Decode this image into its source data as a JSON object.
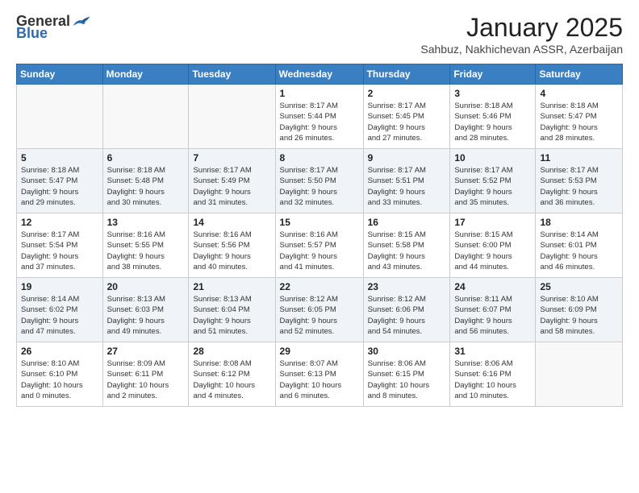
{
  "header": {
    "logo_general": "General",
    "logo_blue": "Blue",
    "month_title": "January 2025",
    "subtitle": "Sahbuz, Nakhichevan ASSR, Azerbaijan"
  },
  "weekdays": [
    "Sunday",
    "Monday",
    "Tuesday",
    "Wednesday",
    "Thursday",
    "Friday",
    "Saturday"
  ],
  "weeks": [
    [
      {
        "day": "",
        "info": ""
      },
      {
        "day": "",
        "info": ""
      },
      {
        "day": "",
        "info": ""
      },
      {
        "day": "1",
        "info": "Sunrise: 8:17 AM\nSunset: 5:44 PM\nDaylight: 9 hours\nand 26 minutes."
      },
      {
        "day": "2",
        "info": "Sunrise: 8:17 AM\nSunset: 5:45 PM\nDaylight: 9 hours\nand 27 minutes."
      },
      {
        "day": "3",
        "info": "Sunrise: 8:18 AM\nSunset: 5:46 PM\nDaylight: 9 hours\nand 28 minutes."
      },
      {
        "day": "4",
        "info": "Sunrise: 8:18 AM\nSunset: 5:47 PM\nDaylight: 9 hours\nand 28 minutes."
      }
    ],
    [
      {
        "day": "5",
        "info": "Sunrise: 8:18 AM\nSunset: 5:47 PM\nDaylight: 9 hours\nand 29 minutes."
      },
      {
        "day": "6",
        "info": "Sunrise: 8:18 AM\nSunset: 5:48 PM\nDaylight: 9 hours\nand 30 minutes."
      },
      {
        "day": "7",
        "info": "Sunrise: 8:17 AM\nSunset: 5:49 PM\nDaylight: 9 hours\nand 31 minutes."
      },
      {
        "day": "8",
        "info": "Sunrise: 8:17 AM\nSunset: 5:50 PM\nDaylight: 9 hours\nand 32 minutes."
      },
      {
        "day": "9",
        "info": "Sunrise: 8:17 AM\nSunset: 5:51 PM\nDaylight: 9 hours\nand 33 minutes."
      },
      {
        "day": "10",
        "info": "Sunrise: 8:17 AM\nSunset: 5:52 PM\nDaylight: 9 hours\nand 35 minutes."
      },
      {
        "day": "11",
        "info": "Sunrise: 8:17 AM\nSunset: 5:53 PM\nDaylight: 9 hours\nand 36 minutes."
      }
    ],
    [
      {
        "day": "12",
        "info": "Sunrise: 8:17 AM\nSunset: 5:54 PM\nDaylight: 9 hours\nand 37 minutes."
      },
      {
        "day": "13",
        "info": "Sunrise: 8:16 AM\nSunset: 5:55 PM\nDaylight: 9 hours\nand 38 minutes."
      },
      {
        "day": "14",
        "info": "Sunrise: 8:16 AM\nSunset: 5:56 PM\nDaylight: 9 hours\nand 40 minutes."
      },
      {
        "day": "15",
        "info": "Sunrise: 8:16 AM\nSunset: 5:57 PM\nDaylight: 9 hours\nand 41 minutes."
      },
      {
        "day": "16",
        "info": "Sunrise: 8:15 AM\nSunset: 5:58 PM\nDaylight: 9 hours\nand 43 minutes."
      },
      {
        "day": "17",
        "info": "Sunrise: 8:15 AM\nSunset: 6:00 PM\nDaylight: 9 hours\nand 44 minutes."
      },
      {
        "day": "18",
        "info": "Sunrise: 8:14 AM\nSunset: 6:01 PM\nDaylight: 9 hours\nand 46 minutes."
      }
    ],
    [
      {
        "day": "19",
        "info": "Sunrise: 8:14 AM\nSunset: 6:02 PM\nDaylight: 9 hours\nand 47 minutes."
      },
      {
        "day": "20",
        "info": "Sunrise: 8:13 AM\nSunset: 6:03 PM\nDaylight: 9 hours\nand 49 minutes."
      },
      {
        "day": "21",
        "info": "Sunrise: 8:13 AM\nSunset: 6:04 PM\nDaylight: 9 hours\nand 51 minutes."
      },
      {
        "day": "22",
        "info": "Sunrise: 8:12 AM\nSunset: 6:05 PM\nDaylight: 9 hours\nand 52 minutes."
      },
      {
        "day": "23",
        "info": "Sunrise: 8:12 AM\nSunset: 6:06 PM\nDaylight: 9 hours\nand 54 minutes."
      },
      {
        "day": "24",
        "info": "Sunrise: 8:11 AM\nSunset: 6:07 PM\nDaylight: 9 hours\nand 56 minutes."
      },
      {
        "day": "25",
        "info": "Sunrise: 8:10 AM\nSunset: 6:09 PM\nDaylight: 9 hours\nand 58 minutes."
      }
    ],
    [
      {
        "day": "26",
        "info": "Sunrise: 8:10 AM\nSunset: 6:10 PM\nDaylight: 10 hours\nand 0 minutes."
      },
      {
        "day": "27",
        "info": "Sunrise: 8:09 AM\nSunset: 6:11 PM\nDaylight: 10 hours\nand 2 minutes."
      },
      {
        "day": "28",
        "info": "Sunrise: 8:08 AM\nSunset: 6:12 PM\nDaylight: 10 hours\nand 4 minutes."
      },
      {
        "day": "29",
        "info": "Sunrise: 8:07 AM\nSunset: 6:13 PM\nDaylight: 10 hours\nand 6 minutes."
      },
      {
        "day": "30",
        "info": "Sunrise: 8:06 AM\nSunset: 6:15 PM\nDaylight: 10 hours\nand 8 minutes."
      },
      {
        "day": "31",
        "info": "Sunrise: 8:06 AM\nSunset: 6:16 PM\nDaylight: 10 hours\nand 10 minutes."
      },
      {
        "day": "",
        "info": ""
      }
    ]
  ]
}
